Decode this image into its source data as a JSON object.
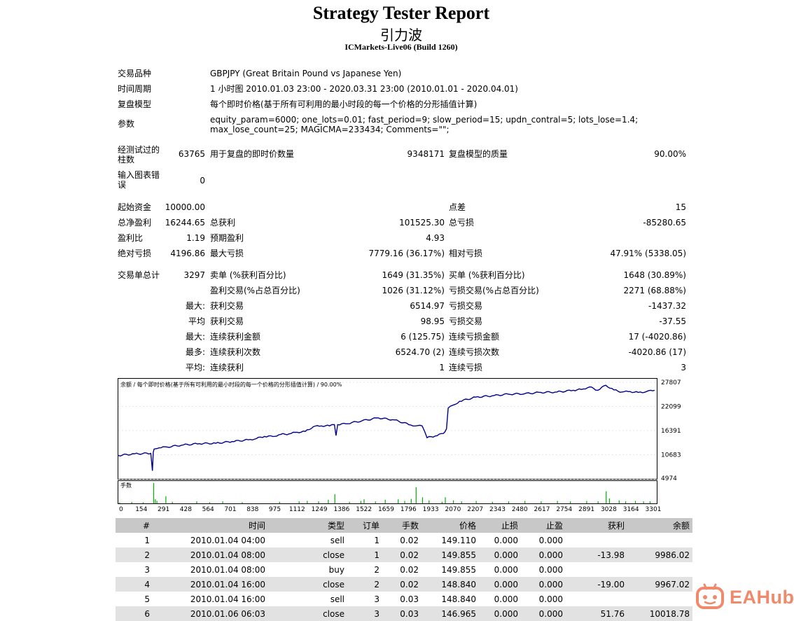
{
  "header": {
    "title": "Strategy Tester Report",
    "subtitle": "引力波",
    "server": "ICMarkets-Live06 (Build 1260)"
  },
  "info": {
    "symbol_label": "交易品种",
    "symbol_value": "GBPJPY (Great Britain Pound vs Japanese Yen)",
    "period_label": "时间周期",
    "period_value": "1 小时图 2010.01.03 23:00 - 2020.03.31 23:00 (2010.01.01 - 2020.04.01)",
    "model_label": "复盘模型",
    "model_value": "每个即时价格(基于所有可利用的最小时段的每一个价格的分形插值计算)",
    "params_label": "参数",
    "params_value": "equity_param=6000; one_lots=0.01; fast_period=9; slow_period=15; updn_contral=5; lots_lose=1.4; max_lose_count=25; MAGICMA=233434; Comments=\"\";"
  },
  "stats": {
    "bars_label": "经测试过的柱数",
    "bars_value": "63765",
    "ticks_label": "用于复盘的即时价数量",
    "ticks_value": "9348171",
    "quality_label": "复盘模型的质量",
    "quality_value": "90.00%",
    "errors_label": "输入图表错误",
    "errors_value": "0",
    "deposit_label": "起始资金",
    "deposit_value": "10000.00",
    "spread_label": "点差",
    "spread_value": "15",
    "net_label": "总净盈利",
    "net_value": "16244.65",
    "gross_profit_label": "总获利",
    "gross_profit_value": "101525.30",
    "gross_loss_label": "总亏损",
    "gross_loss_value": "-85280.65",
    "pf_label": "盈利比",
    "pf_value": "1.19",
    "expected_label": "预期盈利",
    "expected_value": "4.93",
    "abs_dd_label": "绝对亏损",
    "abs_dd_value": "4196.86",
    "max_dd_label": "最大亏损",
    "max_dd_value": "7779.16 (36.17%)",
    "rel_dd_label": "相对亏损",
    "rel_dd_value": "47.91% (5338.05)",
    "total_trades_label": "交易单总计",
    "total_trades_value": "3297",
    "short_label": "卖单 (%获利百分比)",
    "short_value": "1649 (31.35%)",
    "long_label": "买单 (%获利百分比)",
    "long_value": "1648 (30.89%)",
    "profit_trades_label": "盈利交易(%占总百分比)",
    "profit_trades_value": "1026 (31.12%)",
    "loss_trades_label": "亏损交易(%占总百分比)",
    "loss_trades_value": "2271 (68.88%)",
    "largest_label": "最大:",
    "largest_profit_label": "获利交易",
    "largest_profit_value": "6514.97",
    "largest_loss_label": "亏损交易",
    "largest_loss_value": "-1437.32",
    "avg_label": "平均",
    "avg_profit_label": "获利交易",
    "avg_profit_value": "98.95",
    "avg_loss_label": "亏损交易",
    "avg_loss_value": "-37.55",
    "max_label": "最大:",
    "max_cons_wins_label": "连续获利金额",
    "max_cons_wins_value": "6 (125.75)",
    "max_cons_losses_label": "连续亏损金额",
    "max_cons_losses_value": "17 (-4020.86)",
    "most_label": "最多:",
    "most_cons_profit_label": "连续获利次数",
    "most_cons_profit_value": "6524.70 (2)",
    "most_cons_loss_label": "连续亏损次数",
    "most_cons_loss_value": "-4020.86 (17)",
    "avg2_label": "平均:",
    "avg_cons_wins_label": "连续获利",
    "avg_cons_wins_value": "1",
    "avg_cons_losses_label": "连续亏损",
    "avg_cons_losses_value": "3"
  },
  "chart_data": {
    "type": "line",
    "title": "余额 / 每个即时价格(基于所有可利用的最小时段的每一个价格的分形插值计算) / 90.00%",
    "volume_label": "手数",
    "xlim": [
      0,
      3301
    ],
    "ylim": [
      4974,
      27807
    ],
    "x_ticks": [
      "0",
      "154",
      "291",
      "428",
      "564",
      "701",
      "838",
      "975",
      "1112",
      "1249",
      "1386",
      "1522",
      "1659",
      "1796",
      "1933",
      "2070",
      "2207",
      "2343",
      "2480",
      "2617",
      "2754",
      "2891",
      "3028",
      "3164",
      "3301"
    ],
    "y_ticks": [
      "27807",
      "22099",
      "16391",
      "10683",
      "4974"
    ],
    "series": [
      {
        "x": [
          0,
          100,
          200,
          210,
          215,
          220,
          230,
          250,
          300,
          400,
          500,
          600,
          700,
          800,
          850,
          900,
          950,
          1000,
          1050,
          1100,
          1150,
          1200,
          1250,
          1300,
          1330,
          1340,
          1350,
          1400,
          1500,
          1600,
          1700,
          1800,
          1870,
          1900,
          1950,
          2000,
          2020,
          2030,
          2100,
          2200,
          2300,
          2400,
          2500,
          2600,
          2700,
          2800,
          2850,
          2900,
          2950,
          3000,
          3050,
          3100,
          3150,
          3200,
          3250,
          3301
        ],
        "values": [
          10500,
          10900,
          11000,
          6900,
          11300,
          12000,
          12100,
          12300,
          12500,
          13000,
          13300,
          13400,
          13800,
          14200,
          14500,
          15000,
          15000,
          15500,
          15600,
          16000,
          16200,
          17300,
          17500,
          17500,
          17800,
          15200,
          17800,
          18000,
          18700,
          19400,
          18900,
          17700,
          17500,
          14700,
          15100,
          15700,
          16800,
          21700,
          23300,
          24300,
          24600,
          25000,
          25100,
          25400,
          25500,
          25900,
          26100,
          26700,
          25900,
          27100,
          26000,
          25500,
          25600,
          25400,
          25600,
          25900
        ]
      }
    ],
    "volume_bars": [
      {
        "x": 5,
        "v": 0.05
      },
      {
        "x": 80,
        "v": 0.07
      },
      {
        "x": 150,
        "v": 0.05
      },
      {
        "x": 215,
        "v": 1.0
      },
      {
        "x": 225,
        "v": 0.2
      },
      {
        "x": 235,
        "v": 0.12
      },
      {
        "x": 290,
        "v": 0.35
      },
      {
        "x": 330,
        "v": 0.08
      },
      {
        "x": 480,
        "v": 0.1
      },
      {
        "x": 560,
        "v": 0.06
      },
      {
        "x": 640,
        "v": 0.1
      },
      {
        "x": 760,
        "v": 0.06
      },
      {
        "x": 990,
        "v": 0.08
      },
      {
        "x": 1110,
        "v": 0.1
      },
      {
        "x": 1160,
        "v": 0.12
      },
      {
        "x": 1230,
        "v": 0.1
      },
      {
        "x": 1290,
        "v": 0.18
      },
      {
        "x": 1330,
        "v": 0.45
      },
      {
        "x": 1420,
        "v": 0.08
      },
      {
        "x": 1490,
        "v": 0.12
      },
      {
        "x": 1510,
        "v": 0.2
      },
      {
        "x": 1580,
        "v": 0.1
      },
      {
        "x": 1640,
        "v": 0.18
      },
      {
        "x": 1720,
        "v": 0.2
      },
      {
        "x": 1760,
        "v": 0.12
      },
      {
        "x": 1800,
        "v": 0.22
      },
      {
        "x": 1830,
        "v": 0.8
      },
      {
        "x": 1870,
        "v": 0.3
      },
      {
        "x": 1910,
        "v": 0.15
      },
      {
        "x": 1990,
        "v": 0.08
      },
      {
        "x": 2010,
        "v": 0.3
      },
      {
        "x": 2060,
        "v": 0.15
      },
      {
        "x": 2110,
        "v": 0.1
      },
      {
        "x": 2200,
        "v": 0.12
      },
      {
        "x": 2300,
        "v": 0.08
      },
      {
        "x": 2400,
        "v": 0.1
      },
      {
        "x": 2500,
        "v": 0.12
      },
      {
        "x": 2600,
        "v": 0.1
      },
      {
        "x": 2700,
        "v": 0.12
      },
      {
        "x": 2780,
        "v": 0.1
      },
      {
        "x": 2880,
        "v": 0.12
      },
      {
        "x": 2950,
        "v": 0.1
      },
      {
        "x": 3000,
        "v": 0.6
      },
      {
        "x": 3020,
        "v": 0.25
      },
      {
        "x": 3080,
        "v": 0.15
      },
      {
        "x": 3120,
        "v": 0.1
      },
      {
        "x": 3180,
        "v": 0.12
      },
      {
        "x": 3230,
        "v": 0.1
      },
      {
        "x": 3270,
        "v": 0.1
      }
    ]
  },
  "trades": {
    "headers": [
      "#",
      "时间",
      "类型",
      "订单",
      "手数",
      "价格",
      "止损",
      "止盈",
      "获利",
      "余额"
    ],
    "rows": [
      [
        "1",
        "2010.01.04 04:00",
        "sell",
        "1",
        "0.02",
        "149.110",
        "0.000",
        "0.000",
        "",
        ""
      ],
      [
        "2",
        "2010.01.04 08:00",
        "close",
        "1",
        "0.02",
        "149.855",
        "0.000",
        "0.000",
        "-13.98",
        "9986.02"
      ],
      [
        "3",
        "2010.01.04 08:00",
        "buy",
        "2",
        "0.02",
        "149.855",
        "0.000",
        "0.000",
        "",
        ""
      ],
      [
        "4",
        "2010.01.04 16:00",
        "close",
        "2",
        "0.02",
        "148.840",
        "0.000",
        "0.000",
        "-19.00",
        "9967.02"
      ],
      [
        "5",
        "2010.01.04 16:00",
        "sell",
        "3",
        "0.03",
        "148.840",
        "0.000",
        "0.000",
        "",
        ""
      ],
      [
        "6",
        "2010.01.06 06:03",
        "close",
        "3",
        "0.03",
        "146.965",
        "0.000",
        "0.000",
        "51.76",
        "10018.78"
      ]
    ]
  },
  "watermark": {
    "text": "EAHub",
    "color": "#f08a6c"
  }
}
